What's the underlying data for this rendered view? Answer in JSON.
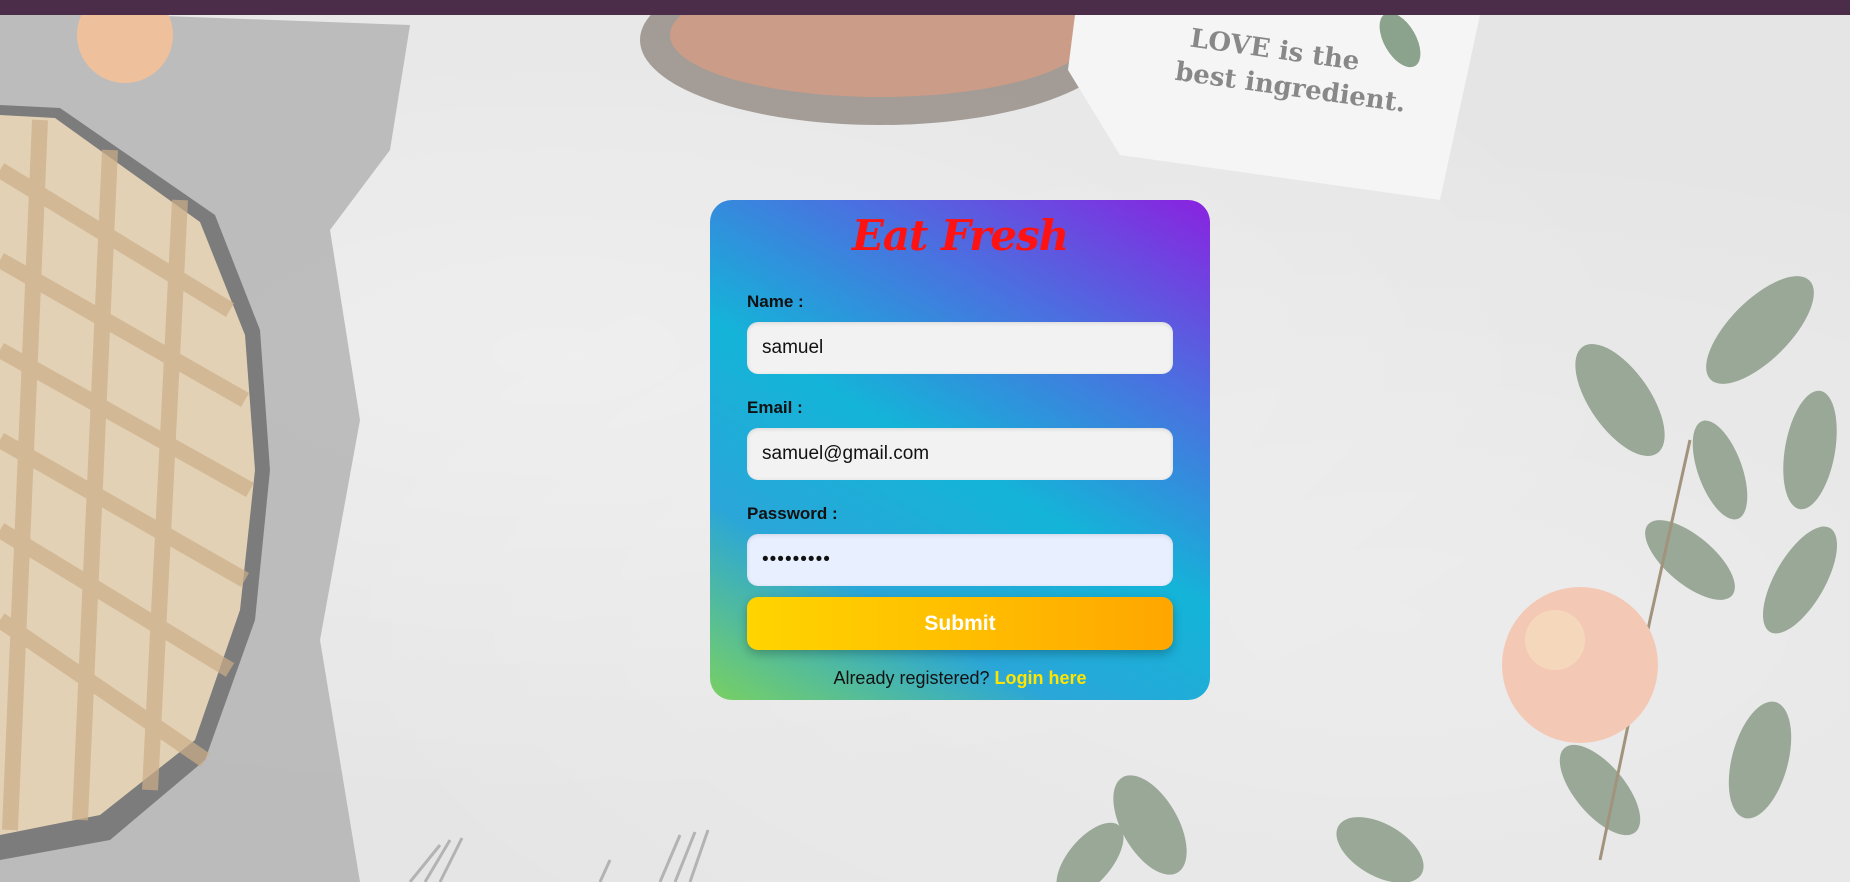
{
  "background": {
    "napkin_text_line1": "LOVE is the",
    "napkin_text_line2": "best ingredient."
  },
  "form": {
    "brand_title": "Eat Fresh",
    "name_label": "Name :",
    "name_value": "samuel",
    "email_label": "Email :",
    "email_value": "samuel@gmail.com",
    "password_label": "Password :",
    "password_value": "samuel123",
    "submit_label": "Submit",
    "registered_prompt": "Already registered?",
    "login_link": "Login here"
  },
  "colors": {
    "top_bar": "#4b2d4a",
    "brand_title": "#ff1212",
    "login_link": "#ffe500",
    "submit_start": "#ffd400",
    "submit_end": "#ffa600",
    "card_gradient_top": "#8a22e0",
    "card_gradient_bottom": "#79d062"
  }
}
